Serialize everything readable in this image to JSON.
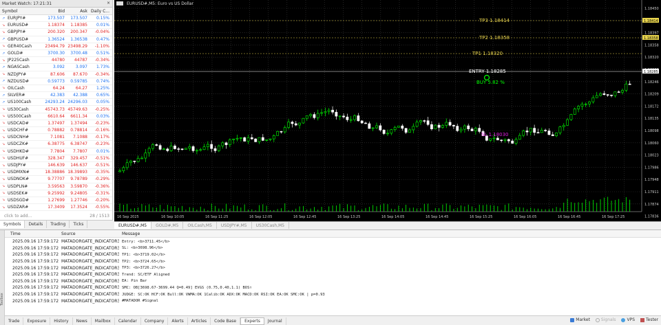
{
  "market_watch": {
    "title": "Market Watch: 17:21:31",
    "columns": [
      "Symbol",
      "Bid",
      "Ask",
      "Daily C..."
    ],
    "rows": [
      {
        "sym": "EURJPY#",
        "bid": "173.507",
        "ask": "173.507",
        "chg": "0.15%",
        "dir": "up"
      },
      {
        "sym": "EURUSD#",
        "bid": "1.18374",
        "ask": "1.18385",
        "chg": "0.01%",
        "dir": "dn"
      },
      {
        "sym": "GBPJPY#",
        "bid": "200.320",
        "ask": "200.347",
        "chg": "-0.04%",
        "dir": "dn"
      },
      {
        "sym": "GBPUSD#",
        "bid": "1.36524",
        "ask": "1.36538",
        "chg": "0.47%",
        "dir": "up"
      },
      {
        "sym": "GER40Cash",
        "bid": "23494.79",
        "ask": "23498.29",
        "chg": "-1.10%",
        "dir": "dn"
      },
      {
        "sym": "GOLD#",
        "bid": "3700.30",
        "ask": "3700.48",
        "chg": "0.51%",
        "dir": "up"
      },
      {
        "sym": "JP225Cash",
        "bid": "44780",
        "ask": "44787",
        "chg": "-0.34%",
        "dir": "dn"
      },
      {
        "sym": "NGASCash",
        "bid": "3.092",
        "ask": "3.097",
        "chg": "1.73%",
        "dir": "up"
      },
      {
        "sym": "NZDJPY#",
        "bid": "87.606",
        "ask": "87.670",
        "chg": "-0.34%",
        "dir": "dn"
      },
      {
        "sym": "NZDUSD#",
        "bid": "0.59773",
        "ask": "0.59785",
        "chg": "0.74%",
        "dir": "up"
      },
      {
        "sym": "OILCash",
        "bid": "64.24",
        "ask": "64.27",
        "chg": "1.25%",
        "dir": "dn"
      },
      {
        "sym": "SILVER#",
        "bid": "42.383",
        "ask": "42.388",
        "chg": "0.65%",
        "dir": "up"
      },
      {
        "sym": "US100Cash",
        "bid": "24293.24",
        "ask": "24296.03",
        "chg": "0.05%",
        "dir": "up"
      },
      {
        "sym": "US30Cash",
        "bid": "45743.73",
        "ask": "45749.63",
        "chg": "-0.25%",
        "dir": "dn"
      },
      {
        "sym": "US500Cash",
        "bid": "6610.64",
        "ask": "6611.34",
        "chg": "0.03%",
        "dir": "dn"
      },
      {
        "sym": "USDCAD#",
        "bid": "1.37497",
        "ask": "1.37494",
        "chg": "-0.23%",
        "dir": "dn"
      },
      {
        "sym": "USDCHF#",
        "bid": "0.78882",
        "ask": "0.78814",
        "chg": "-0.16%",
        "dir": "dn"
      },
      {
        "sym": "USDCNH#",
        "bid": "7.1081",
        "ask": "7.1088",
        "chg": "-0.17%",
        "dir": "dn"
      },
      {
        "sym": "USDCZK#",
        "bid": "6.38775",
        "ask": "6.38747",
        "chg": "-0.23%",
        "dir": "dn"
      },
      {
        "sym": "USDHKD#",
        "bid": "7.7804",
        "ask": "7.7807",
        "chg": "0.01%",
        "dir": "dn"
      },
      {
        "sym": "USDHUF#",
        "bid": "328.347",
        "ask": "329.457",
        "chg": "-0.51%",
        "dir": "dn"
      },
      {
        "sym": "USDJPY#",
        "bid": "146.639",
        "ask": "146.637",
        "chg": "-0.51%",
        "dir": "dn"
      },
      {
        "sym": "USDMXN#",
        "bid": "18.38886",
        "ask": "18.39893",
        "chg": "-0.35%",
        "dir": "dn"
      },
      {
        "sym": "USDNOK#",
        "bid": "9.77707",
        "ask": "9.78789",
        "chg": "-0.29%",
        "dir": "dn"
      },
      {
        "sym": "USDPLN#",
        "bid": "3.59563",
        "ask": "3.59870",
        "chg": "-0.36%",
        "dir": "dn"
      },
      {
        "sym": "USDSEK#",
        "bid": "9.25992",
        "ask": "9.24805",
        "chg": "-0.31%",
        "dir": "dn"
      },
      {
        "sym": "USDSGD#",
        "bid": "1.27699",
        "ask": "1.27746",
        "chg": "-0.20%",
        "dir": "dn"
      },
      {
        "sym": "USDZAR#",
        "bid": "17.3409",
        "ask": "17.3524",
        "chg": "-0.55%",
        "dir": "dn"
      }
    ],
    "add_label": "click to add...",
    "count_label": "28 / 1513",
    "tabs": [
      "Symbols",
      "Details",
      "Trading",
      "Ticks"
    ]
  },
  "chart": {
    "title": "EURUSD#,M5: Euro vs US Dollar",
    "colors": {
      "bg": "#000000",
      "bull": "#00ff00",
      "bear": "#ffffff",
      "grid": "#3a3a3a",
      "tp": "#e8d44d",
      "sl": "#e020e0",
      "entry": "#ffffff"
    },
    "price_labels": [
      "1.18450",
      "1.18414",
      "1.18397",
      "1.18358",
      "1.18320",
      "1.18283",
      "1.18246",
      "1.18209",
      "1.18172",
      "1.18135",
      "1.18098",
      "1.18060",
      "1.18023",
      "1.17986",
      "1.17948",
      "1.17911",
      "1.17874",
      "1.17836"
    ],
    "highlight_labels": {
      "tp3": "1.18414",
      "tp2": "1.18358",
      "entry": "1.18285",
      "ask": "1.18374"
    },
    "annotations": {
      "tp3": "TP3 1.18414",
      "tp2": "TP2 1.18358",
      "tp1": "TP1 1.18320",
      "entry": "ENTRY 1.18285",
      "buy": "BUY 5.82 %",
      "sl": "SL 1.18030"
    },
    "time_labels": [
      "16 Sep 2025",
      "16 Sep 10:05",
      "16 Sep 11:25",
      "16 Sep 12:05",
      "16 Sep 12:45",
      "16 Sep 13:25",
      "16 Sep 14:05",
      "16 Sep 14:45",
      "16 Sep 15:25",
      "16 Sep 16:05",
      "16 Sep 16:45",
      "16 Sep 17:25"
    ],
    "tabs": [
      "EURUSD#,M5",
      "GOLD#,M5",
      "OILCash,M5",
      "USDJPY#,M5",
      "US30Cash,M5"
    ]
  },
  "toolbox": {
    "side_label": "Toolbox",
    "columns": [
      "Time",
      "Source",
      "Message"
    ],
    "rows": [
      {
        "time": "2025.09.16 17:59:172",
        "src": "MATADORGATE_INDICATOR3 (...",
        "msg": "Entry: <b>3711.45</b>"
      },
      {
        "time": "2025.09.16 17:59:172",
        "src": "MATADORGATE_INDICATOR3 (...",
        "msg": "SL: <b>3698.96</b>"
      },
      {
        "time": "2025.09.16 17:59:172",
        "src": "MATADORGATE_INDICATOR3 (...",
        "msg": "TP1: <b>3719.02</b>"
      },
      {
        "time": "2025.09.16 17:59:172",
        "src": "MATADORGATE_INDICATOR3 (...",
        "msg": "TP2: <b>3724.65</b>"
      },
      {
        "time": "2025.09.16 17:59:172",
        "src": "MATADORGATE_INDICATOR3 (...",
        "msg": "TP3: <b>3726.27</b>"
      },
      {
        "time": "2025.09.16 17:59:172",
        "src": "MATADORGATE_INDICATOR3 (...",
        "msg": "Trend: SC/ETF Aligned"
      },
      {
        "time": "2025.09.16 17:59:172",
        "src": "MATADORGATE_INDICATOR3 (...",
        "msg": "EA: Pin Bar"
      },
      {
        "time": "2025.09.16 17:59:172",
        "src": "MATADORGATE_INDICATOR3 (...",
        "msg": "SMC: OB[3698.67-3699.44 Q=0.49] EVGS (0.75,0.40,1.1) BOS↑"
      },
      {
        "time": "2025.09.16 17:59:172",
        "src": "MATADORGATE_INDICATOR3 (...",
        "msg": "JUDGE: SC:OK HCF:OK Bull:OK VWMA:OK 1Calib:OK ADX:OK MACD:OK RSI:OK EA:OK SMC:OK | p=0.93"
      },
      {
        "time": "2025.09.16 17:59:172",
        "src": "MATADORGATE_INDICATOR3 (...",
        "msg": "#MATADOR #Signal"
      }
    ],
    "tabs": [
      "Trade",
      "Exposure",
      "History",
      "News",
      "Mailbox",
      "Calendar",
      "Company",
      "Alerts",
      "Articles",
      "Code Base",
      "Experts",
      "Journal"
    ],
    "active_tab": "Experts",
    "right_items": [
      "Market",
      "Signals",
      "VPS",
      "Tester"
    ]
  }
}
